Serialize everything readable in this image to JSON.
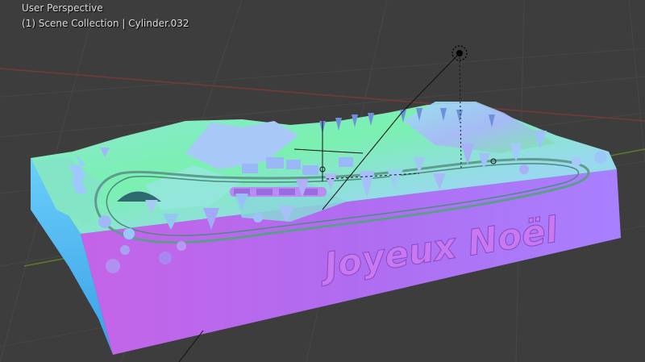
{
  "viewport": {
    "mode_label": "User Perspective",
    "collection_label": "(1) Scene Collection | Cylinder.032"
  },
  "scene": {
    "model_text": "Joyeux Noël",
    "objects": [
      "diorama-base",
      "mountains",
      "trees",
      "train",
      "railway",
      "sun-lamp",
      "text-object"
    ]
  },
  "colors": {
    "background": "#3d3d3d",
    "grid": "#4a4a4a",
    "axis_x": "#8a3a3a",
    "axis_y": "#6b8a2e",
    "front_face": "#b95ee8",
    "side_face": "#4ab8f2",
    "top_face": "#78e6c8",
    "text_color": "#c878f0"
  }
}
